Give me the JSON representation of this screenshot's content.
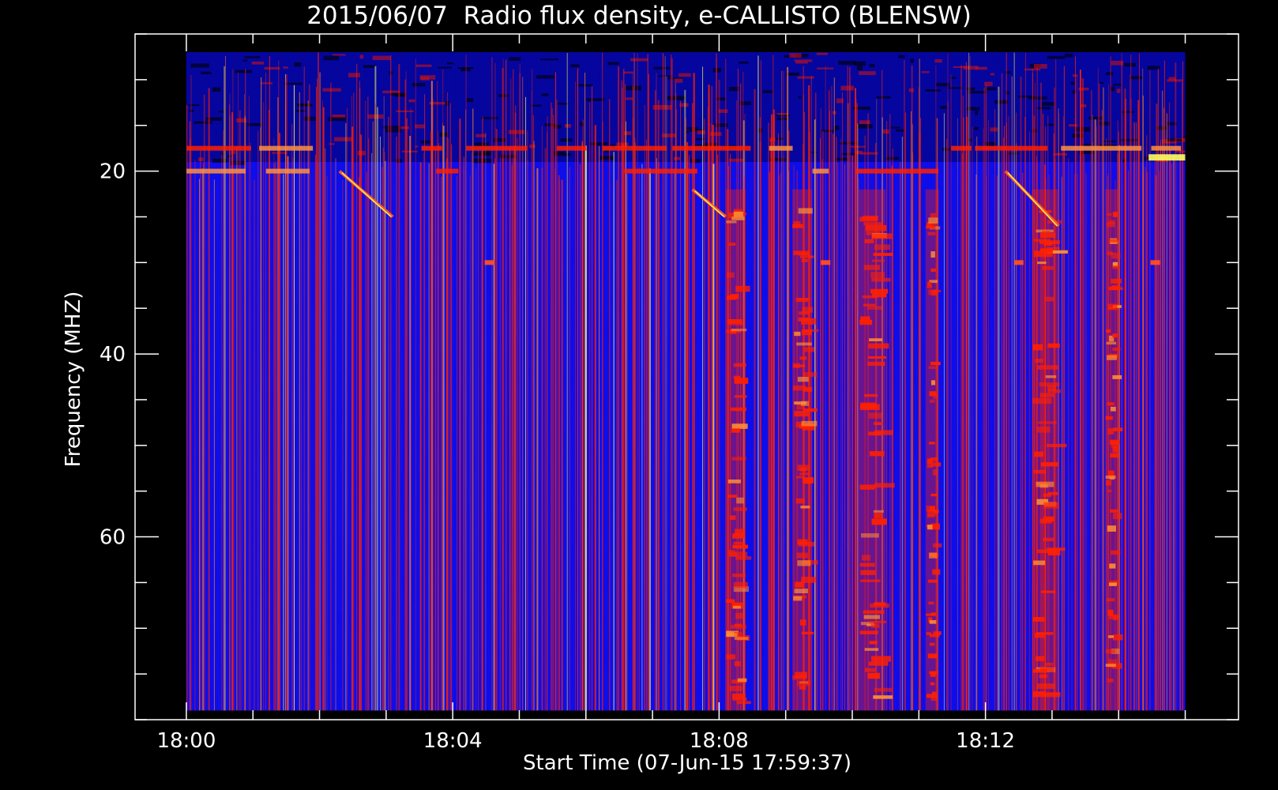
{
  "chart_data": {
    "type": "heatmap",
    "title": "2015/06/07  Radio flux density, e-CALLISTO (BLENSW)",
    "xlabel": "Start Time (07-Jun-15 17:59:37)",
    "ylabel": "Frequency (MHZ)",
    "x_ticks": [
      {
        "label": "18:00",
        "minutes": 0
      },
      {
        "label": "18:04",
        "minutes": 4
      },
      {
        "label": "18:08",
        "minutes": 8
      },
      {
        "label": "18:12",
        "minutes": 12
      }
    ],
    "x_minor_step_minutes": 1,
    "xlim_minutes_after_1800": [
      -0.77,
      15.8
    ],
    "data_x_range_minutes_after_1800": [
      0,
      15.0
    ],
    "y_ticks": [
      20,
      40,
      60
    ],
    "y_minor_step": 5,
    "ylim": [
      80,
      5
    ],
    "data_y_range": [
      7,
      79
    ],
    "colormap": {
      "low": "#0000cc",
      "mid": "#2020ff",
      "high": "#ff2000",
      "peak": "#ffff60",
      "quiet": "#000000"
    },
    "features": [
      {
        "kind": "burst-band",
        "start": "18:08.1",
        "end": "18:08.4"
      },
      {
        "kind": "burst-band",
        "start": "18:09.1",
        "end": "18:09.4"
      },
      {
        "kind": "burst-band",
        "start": "18:10.1",
        "end": "18:10.5"
      },
      {
        "kind": "burst-band",
        "start": "18:11.1",
        "end": "18:11.3"
      },
      {
        "kind": "burst-band",
        "start": "18:12.7",
        "end": "18:13.1"
      },
      {
        "kind": "burst-band",
        "start": "18:13.8",
        "end": "18:14.0"
      },
      {
        "kind": "drifting-burst",
        "start": "18:02.3",
        "end": "18:03.1",
        "freq_start": 20,
        "freq_end": 25
      },
      {
        "kind": "drifting-burst",
        "start": "18:07.6",
        "end": "18:08.1",
        "freq_start": 22,
        "freq_end": 25
      },
      {
        "kind": "drifting-burst",
        "start": "18:12.3",
        "end": "18:13.1",
        "freq_start": 20,
        "freq_end": 26
      },
      {
        "kind": "rfi-line",
        "freq": 17.5
      },
      {
        "kind": "rfi-line",
        "freq": 20
      }
    ]
  },
  "colors": {
    "background": "#000000",
    "axes": "#ffffff",
    "text": "#ffffff"
  }
}
